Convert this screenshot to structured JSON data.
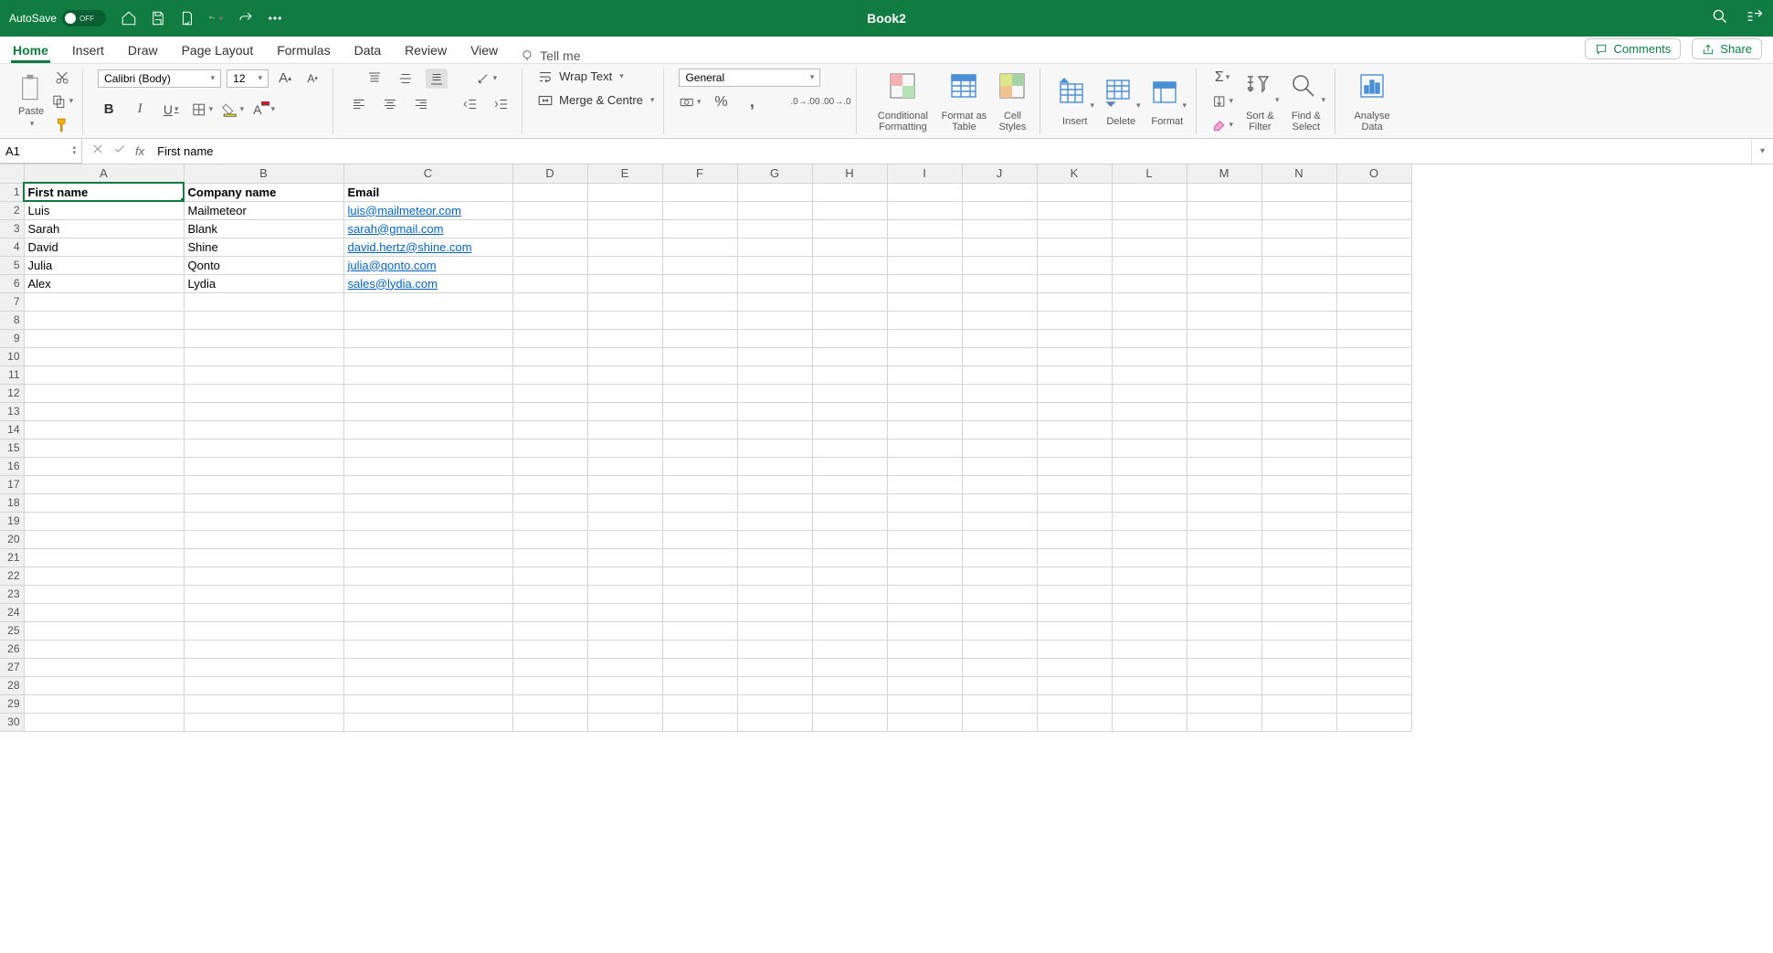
{
  "titlebar": {
    "autosave": "AutoSave",
    "autosave_state": "OFF",
    "title": "Book2"
  },
  "tabs": {
    "items": [
      "Home",
      "Insert",
      "Draw",
      "Page Layout",
      "Formulas",
      "Data",
      "Review",
      "View"
    ],
    "tellme": "Tell me",
    "comments": "Comments",
    "share": "Share"
  },
  "ribbon": {
    "paste": "Paste",
    "font_name": "Calibri (Body)",
    "font_size": "12",
    "wrap_text": "Wrap Text",
    "merge_centre": "Merge & Centre",
    "number_format": "General",
    "cond_fmt": "Conditional Formatting",
    "fmt_table": "Format as Table",
    "cell_styles": "Cell Styles",
    "insert": "Insert",
    "delete": "Delete",
    "format": "Format",
    "sort_filter": "Sort & Filter",
    "find_select": "Find & Select",
    "analyse": "Analyse Data"
  },
  "formula_bar": {
    "cell_ref": "A1",
    "formula": "First name"
  },
  "sheet": {
    "columns": [
      "A",
      "B",
      "C",
      "D",
      "E",
      "F",
      "G",
      "H",
      "I",
      "J",
      "K",
      "L",
      "M",
      "N",
      "O"
    ],
    "headers": [
      "First name",
      "Company name",
      "Email"
    ],
    "rows": [
      {
        "first": "Luis",
        "company": "Mailmeteor",
        "email": "luis@mailmeteor.com"
      },
      {
        "first": "Sarah",
        "company": "Blank",
        "email": "sarah@gmail.com"
      },
      {
        "first": "David",
        "company": "Shine",
        "email": "david.hertz@shine.com"
      },
      {
        "first": "Julia",
        "company": "Qonto",
        "email": "julia@qonto.com"
      },
      {
        "first": "Alex",
        "company": "Lydia",
        "email": "sales@lydia.com"
      }
    ],
    "total_visible_rows": 30
  }
}
